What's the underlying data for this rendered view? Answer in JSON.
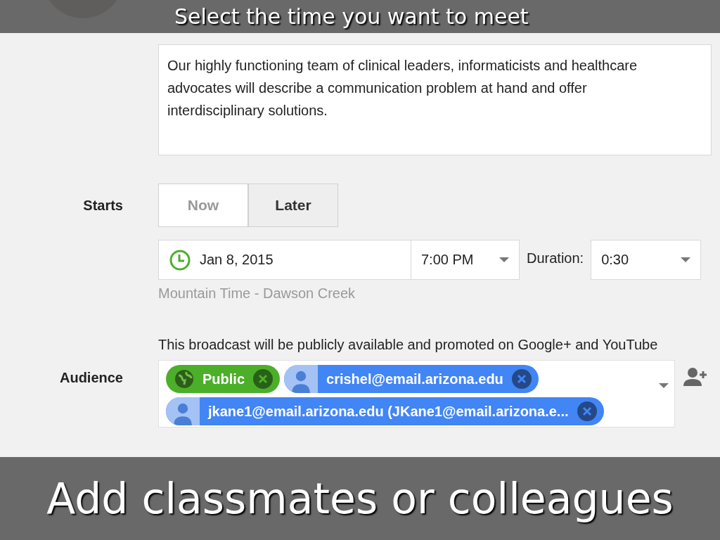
{
  "top_caption": "Select the time you want to meet",
  "description": {
    "value": "Our highly functioning team of clinical leaders, informaticists and healthcare advocates will describe a communication problem at hand and offer interdisciplinary solutions."
  },
  "starts": {
    "label": "Starts",
    "options": [
      {
        "label": "Now",
        "selected": false
      },
      {
        "label": "Later",
        "selected": true
      }
    ]
  },
  "date": "Jan 8, 2015",
  "time": "7:00 PM",
  "duration_label": "Duration:",
  "duration": "0:30",
  "timezone": "Mountain Time - Dawson Creek",
  "notice": "This broadcast will be publicly available and promoted on Google+ and YouTube",
  "audience": {
    "label": "Audience",
    "chips": [
      {
        "kind": "public",
        "label": "Public",
        "color": "#4caf2a"
      },
      {
        "kind": "person",
        "label": "crishel@email.arizona.edu",
        "color": "#4285f4"
      },
      {
        "kind": "person",
        "label": "jkane1@email.arizona.edu (JKane1@email.arizona.e...",
        "color": "#4285f4"
      }
    ]
  },
  "bottom_caption": "Add classmates or colleagues"
}
